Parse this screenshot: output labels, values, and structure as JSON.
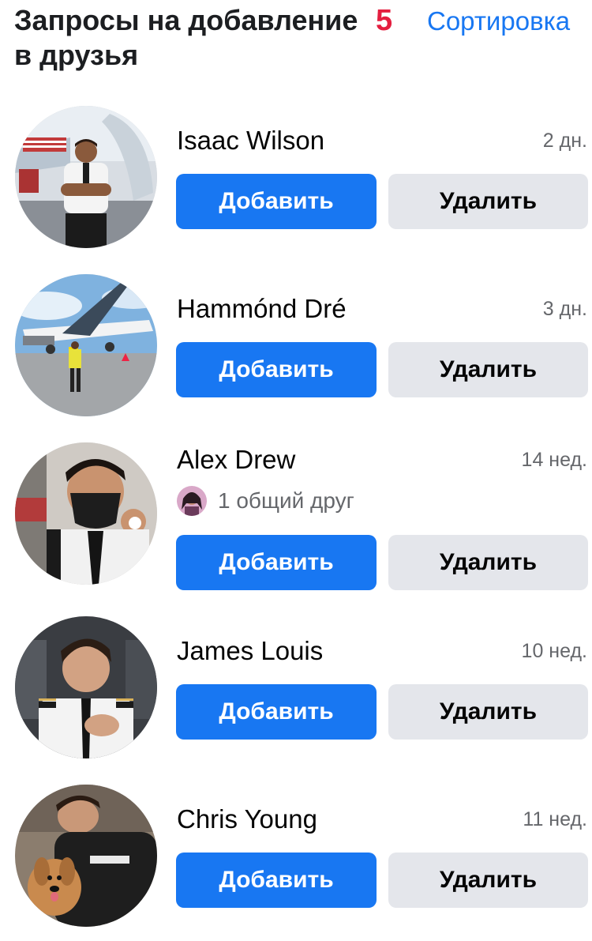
{
  "header": {
    "title": "Запросы на добавление в друзья",
    "count": "5",
    "sort_label": "Сортировка"
  },
  "requests": [
    {
      "name": "Isaac Wilson",
      "time": "2 дн.",
      "mutual": "",
      "add_label": "Добавить",
      "delete_label": "Удалить"
    },
    {
      "name": "Hammónd Dré",
      "time": "3 дн.",
      "mutual": "",
      "add_label": "Добавить",
      "delete_label": "Удалить"
    },
    {
      "name": "Alex Drew",
      "time": "14 нед.",
      "mutual": "1 общий друг",
      "add_label": "Добавить",
      "delete_label": "Удалить"
    },
    {
      "name": "James Louis",
      "time": "10 нед.",
      "mutual": "",
      "add_label": "Добавить",
      "delete_label": "Удалить"
    },
    {
      "name": "Chris Young",
      "time": "11 нед.",
      "mutual": "",
      "add_label": "Добавить",
      "delete_label": "Удалить"
    }
  ],
  "colors": {
    "accent": "#1877f2",
    "count": "#e41e3f",
    "secondary_button": "#e4e6eb",
    "muted_text": "#65676b"
  }
}
